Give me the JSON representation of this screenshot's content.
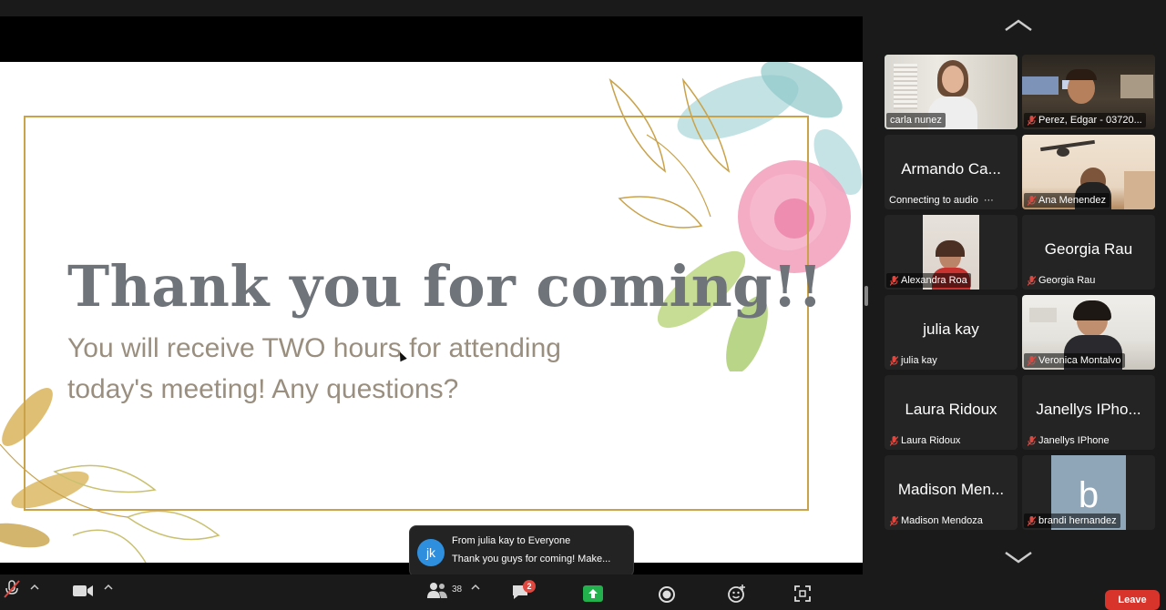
{
  "slide": {
    "title": "Thank you for coming!!",
    "subtitle": "You will receive TWO hours for attending today's meeting! Any questions?"
  },
  "participants": [
    {
      "name": "carla nunez",
      "video": true,
      "active": true,
      "muted": false
    },
    {
      "name": "Perez, Edgar - 03720...",
      "video": true,
      "muted": true
    },
    {
      "name": "Armando Ca...",
      "status": "Connecting to audio",
      "more": "···",
      "video": false
    },
    {
      "name": "Ana Menendez",
      "video": true,
      "muted": true
    },
    {
      "name": "Alexandra Roa",
      "video": true,
      "muted": true
    },
    {
      "name": "Georgia Rau",
      "display": "Georgia Rau",
      "video": false,
      "muted": true
    },
    {
      "name": "julia kay",
      "display": "julia kay",
      "video": false,
      "muted": true
    },
    {
      "name": "Veronica Montalvo",
      "video": true,
      "muted": true
    },
    {
      "name": "Laura Ridoux",
      "display": "Laura Ridoux",
      "video": false,
      "muted": true
    },
    {
      "name": "Janellys IPhone",
      "display": "Janellys IPho...",
      "video": false,
      "muted": true
    },
    {
      "name": "Madison Mendoza",
      "display": "Madison Men...",
      "video": false,
      "muted": true
    },
    {
      "name": "brandi hernandez",
      "avatar_letter": "b",
      "video": false,
      "muted": true
    }
  ],
  "chat_toast": {
    "avatar": "jk",
    "from": "From julia kay to Everyone",
    "message": "Thank you guys for coming! Make..."
  },
  "toolbar": {
    "participants_count": "38",
    "chat_badge": "2",
    "leave_label": "Leave"
  },
  "colors": {
    "active_speaker": "#3ecf5a",
    "mic_muted": "#e0473e",
    "share_green": "#22b14c",
    "leave_red": "#d8342c",
    "chat_avatar": "#2e8fdf"
  },
  "icons": [
    "mic-off-icon",
    "video-icon",
    "participants-icon",
    "chat-icon",
    "share-screen-icon",
    "record-icon",
    "reactions-icon",
    "apps-icon",
    "chevron-up-icon",
    "chevron-down-icon"
  ]
}
